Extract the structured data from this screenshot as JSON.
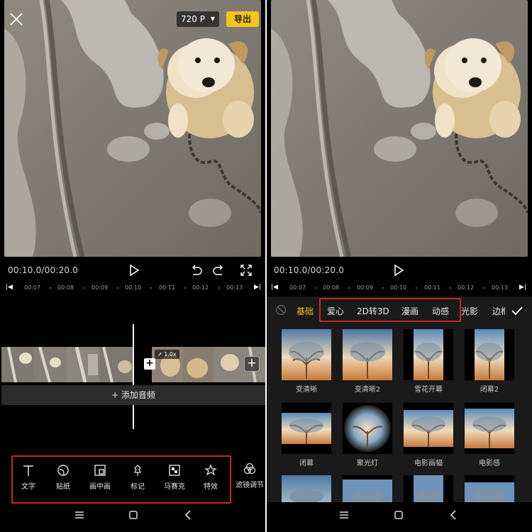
{
  "left": {
    "resolution": "720 P",
    "export_label": "导出",
    "timecode": "00:10.0/00:20.0",
    "ruler_ticks": [
      "00:07",
      "00:08",
      "00:09",
      "00:10",
      "00:11",
      "00:12",
      "00:13"
    ],
    "speed_tag": "1.0x",
    "add_audio": "+ 添加音频",
    "tools": [
      "文字",
      "贴纸",
      "画中画",
      "标记",
      "马赛克",
      "特效"
    ],
    "tool_outside": "滤镜调节"
  },
  "right": {
    "timecode": "00:10.0/00:20.0",
    "ruler_ticks": [
      "00:07",
      "00:08",
      "00:09",
      "00:10",
      "00:11",
      "00:12",
      "00:13"
    ],
    "tabs": [
      "基础",
      "爱心",
      "2D转3D",
      "漫画",
      "动感",
      "光影",
      "边框"
    ],
    "active_tab": "基础",
    "effects": [
      "变清晰",
      "变清晰2",
      "雪花开幕",
      "闭幕2",
      "闭幕",
      "聚光灯",
      "电影画幅",
      "电影感"
    ]
  },
  "colors": {
    "accent": "#f5c518",
    "highlight_box": "#c62828"
  }
}
